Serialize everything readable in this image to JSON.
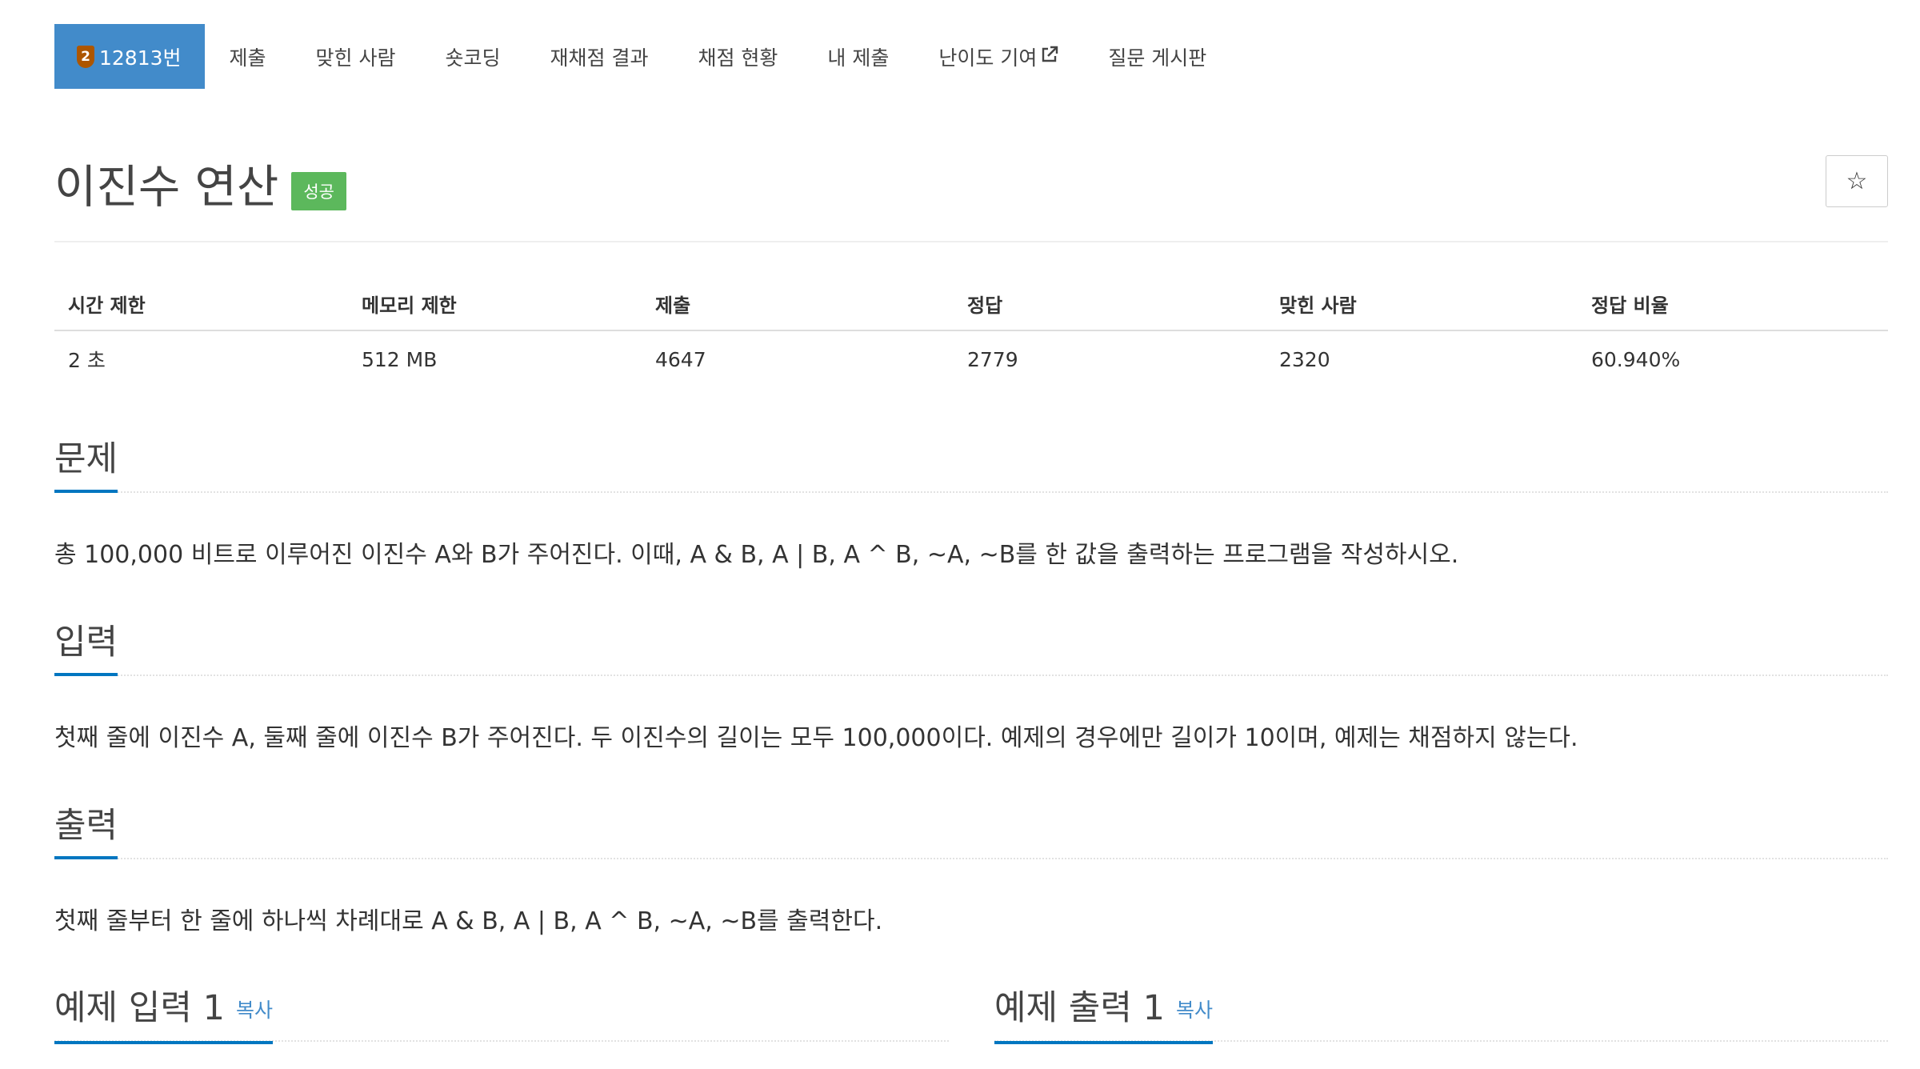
{
  "nav": {
    "problem_tab": {
      "tier": "2",
      "label": "12813번"
    },
    "items": [
      {
        "label": "제출"
      },
      {
        "label": "맞힌 사람"
      },
      {
        "label": "숏코딩"
      },
      {
        "label": "재채점 결과"
      },
      {
        "label": "채점 현황"
      },
      {
        "label": "내 제출"
      },
      {
        "label": "난이도 기여"
      },
      {
        "label": "질문 게시판"
      }
    ]
  },
  "problem": {
    "title": "이진수 연산",
    "status_label": "성공",
    "star_icon": "☆"
  },
  "info_table": {
    "headers": [
      "시간 제한",
      "메모리 제한",
      "제출",
      "정답",
      "맞힌 사람",
      "정답 비율"
    ],
    "values": [
      "2 초",
      "512 MB",
      "4647",
      "2779",
      "2320",
      "60.940%"
    ]
  },
  "sections": {
    "description": {
      "title": "문제",
      "text": "총 100,000 비트로 이루어진 이진수 A와 B가 주어진다. 이때, A & B, A | B, A ^ B, ~A, ~B를 한 값을 출력하는 프로그램을 작성하시오."
    },
    "input": {
      "title": "입력",
      "text": "첫째 줄에 이진수 A, 둘째 줄에 이진수 B가 주어진다. 두 이진수의 길이는 모두 100,000이다. 예제의 경우에만 길이가 10이며, 예제는 채점하지 않는다."
    },
    "output": {
      "title": "출력",
      "text": "첫째 줄부터 한 줄에 하나씩 차례대로 A & B, A | B, A ^ B, ~A, ~B를 출력한다."
    },
    "sample_input": {
      "title": "예제 입력 1",
      "copy_label": "복사"
    },
    "sample_output": {
      "title": "예제 출력 1",
      "copy_label": "복사"
    }
  },
  "colors": {
    "active_tab": "#428bca",
    "success_label": "#5cb85c",
    "section_underline": "#0076c0",
    "link": "#428bca",
    "tier_bronze": "#ad5600"
  }
}
